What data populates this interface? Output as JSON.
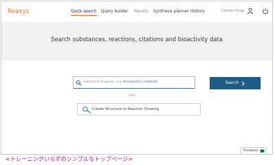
{
  "brand": {
    "logo": "Reaxys",
    "accent": "#e9711c",
    "primary": "#1d5c86"
  },
  "nav": {
    "items": [
      {
        "label": "Quick search",
        "active": true
      },
      {
        "label": "Query builder",
        "active": false
      },
      {
        "label": "Results",
        "active": false,
        "disabled": true
      },
      {
        "label": "Synthesis planner",
        "active": false
      },
      {
        "label": "History",
        "active": false
      }
    ],
    "user_label": "Chester Ringo",
    "user_icon": "user-icon",
    "help_icon": "power-icon"
  },
  "hero": {
    "title": "Search substances, reactions, citations and bioactivity data"
  },
  "search": {
    "prefix": "Substance Property, e.g. ",
    "example": "ferroelectric materials",
    "button_label": "Search",
    "or_label": "AND"
  },
  "draw": {
    "label": "Create Structure or Reaction Drawing"
  },
  "feedback": {
    "label": "Feedback"
  },
  "caption": "<トレーニングいらずのシンプルなトップページ>"
}
